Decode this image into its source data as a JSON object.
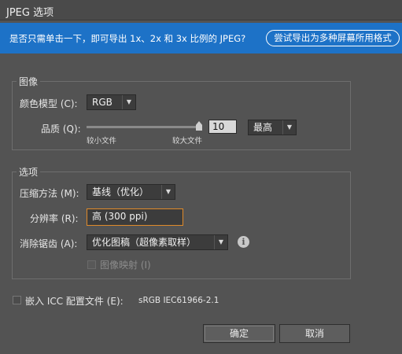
{
  "window": {
    "title": "JPEG 选项"
  },
  "banner": {
    "message": "是否只需单击一下，即可导出 1x、2x 和 3x 比例的 JPEG?",
    "button": "尝试导出为多种屏幕所用格式"
  },
  "image_group": {
    "title": "图像",
    "color_model_label": "颜色模型 (C):",
    "color_model_value": "RGB",
    "quality_label": "品质 (Q):",
    "quality_value": "10",
    "quality_preset": "最高",
    "slider_min_label": "较小文件",
    "slider_max_label": "较大文件",
    "slider_level": 1.0
  },
  "options_group": {
    "title": "选项",
    "compression_label": "压缩方法 (M):",
    "compression_value": "基线（优化）",
    "resolution_label": "分辨率 (R):",
    "resolution_value": "高 (300 ppi)",
    "antialias_label": "消除锯齿 (A):",
    "antialias_value": "优化图稿（超像素取样）",
    "imagemap_label": "图像映射 (I)",
    "imagemap_checked": false
  },
  "icc": {
    "label": "嵌入 ICC 配置文件 (E):",
    "profile": "sRGB IEC61966-2.1",
    "checked": false
  },
  "buttons": {
    "ok": "确定",
    "cancel": "取消"
  },
  "icons": {
    "dropdown": "chevron-down-icon",
    "info": "info-icon"
  },
  "colors": {
    "banner": "#1d72c7",
    "background": "#535353",
    "focus_outline": "#e08a2a"
  }
}
